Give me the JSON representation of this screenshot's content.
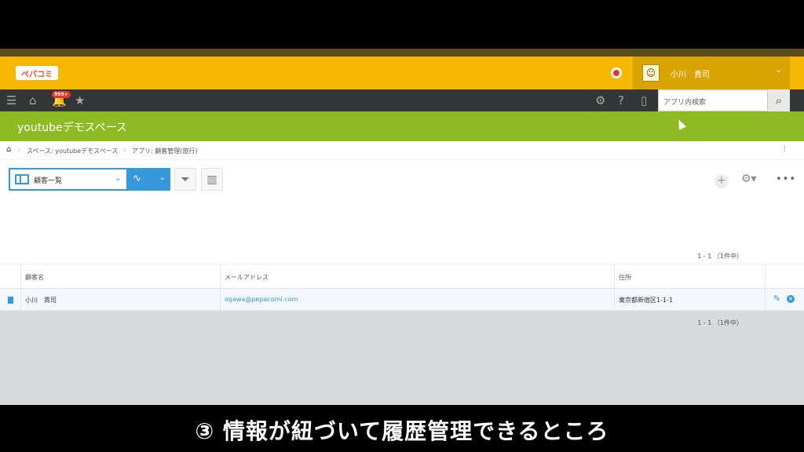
{
  "header": {
    "logo_text": "ぺパコミ",
    "user_name": "小川　貴司"
  },
  "toolbar": {
    "notification_badge": "999+",
    "search_placeholder": "アプリ内検索"
  },
  "space": {
    "title": "youtubeデモスペース"
  },
  "breadcrumb": {
    "space": "スペース: youtubeデモスペース",
    "app": "アプリ: 顧客管理(旅行)"
  },
  "view": {
    "selected": "顧客一覧"
  },
  "pager": {
    "top": "1 - 1 （1件中）",
    "bottom": "1 - 1 （1件中）"
  },
  "table": {
    "columns": [
      "顧客名",
      "メールアドレス",
      "住所"
    ],
    "rows": [
      {
        "name": "小川　貴司",
        "email": "ogawa@pepacomi.com",
        "address": "東京都新宿区1-1-1"
      }
    ]
  },
  "caption": {
    "text": "③ 情報が紐づいて履歴管理できるところ"
  },
  "colors": {
    "brand_yellow": "#f5b800",
    "space_green": "#8dbb22",
    "accent_blue": "#3498db",
    "toolbar_dark": "#333536"
  }
}
